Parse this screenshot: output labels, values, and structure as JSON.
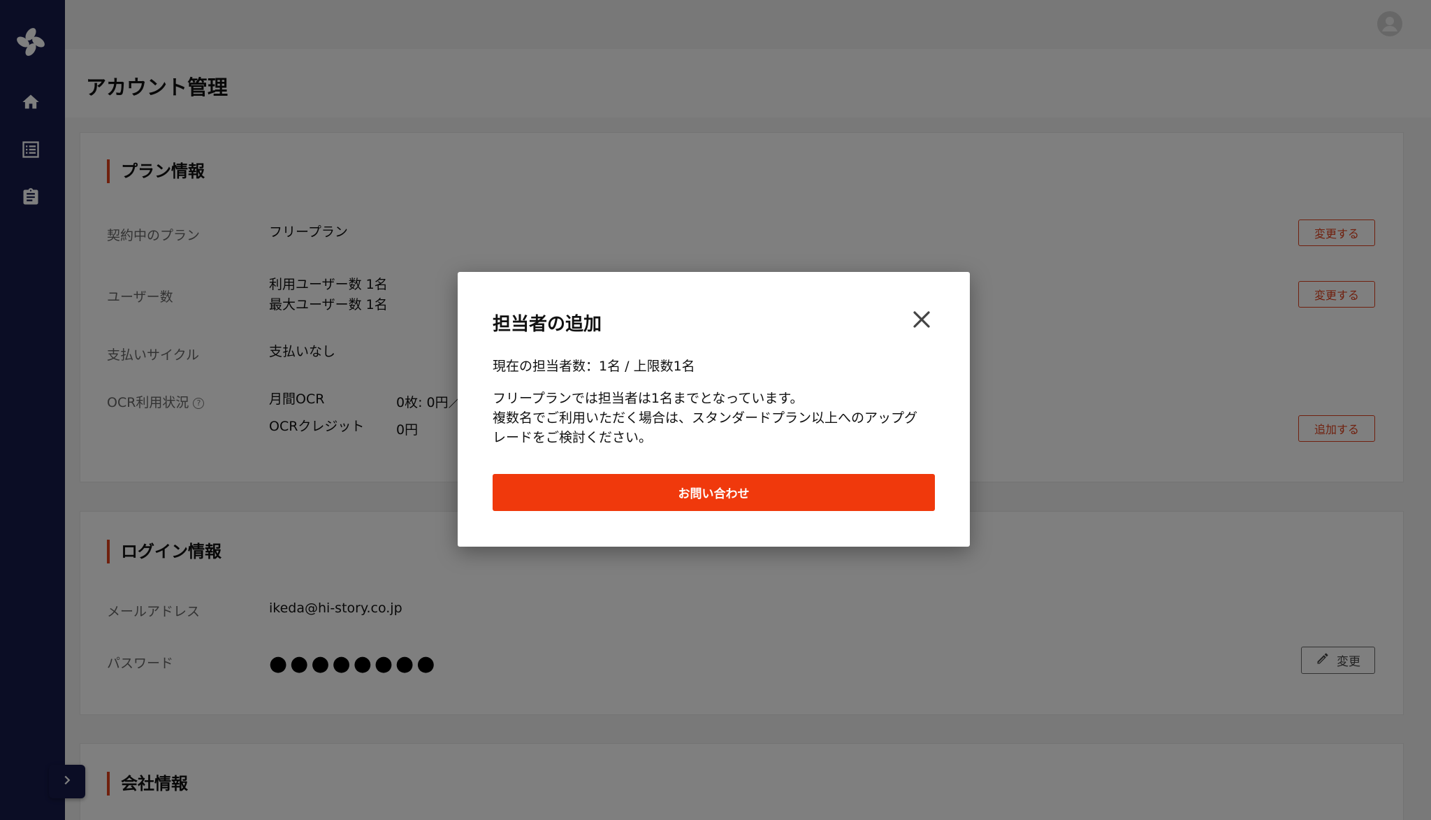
{
  "colors": {
    "sidebar": "#161a4b",
    "accent": "#e1401c",
    "primary_button": "#f0390c"
  },
  "sidebar": {
    "logo": "brand-logo",
    "items": [
      {
        "icon": "home-icon"
      },
      {
        "icon": "list-icon"
      },
      {
        "icon": "clipboard-icon"
      }
    ],
    "expand_icon": "chevron-right-icon"
  },
  "header": {
    "title": "アカウント管理",
    "avatar_icon": "user-avatar-icon"
  },
  "plan": {
    "title": "プラン情報",
    "contract_label": "契約中のプラン",
    "contract_value": "フリープラン",
    "change_label": "変更する",
    "users_label": "ユーザー数",
    "users_current": "利用ユーザー数 1名",
    "users_max": "最大ユーザー数 1名",
    "users_change_label": "変更する",
    "cycle_label": "支払いサイクル",
    "cycle_value": "支払いなし",
    "ocr_label": "OCR利用状況",
    "ocr_help": "?",
    "ocr_monthly_label": "月間OCR",
    "ocr_monthly_value": "0枚: 0円／",
    "ocr_credit_label": "OCRクレジット",
    "ocr_credit_value": "0円",
    "add_label": "追加する"
  },
  "login": {
    "title": "ログイン情報",
    "email_label": "メールアドレス",
    "email_value": "ikeda@hi-story.co.jp",
    "password_label": "パスワード",
    "password_value": "●●●●●●●●",
    "password_change_label": "変更"
  },
  "company": {
    "title": "会社情報"
  },
  "modal": {
    "title": "担当者の追加",
    "close_icon": "close-icon",
    "count_text": "現在の担当者数：1名 / 上限数1名",
    "message_line1": "フリープランでは担当者は1名までとなっています。",
    "message_line2": "複数名でご利用いただく場合は、スタンダードプラン以上へのアップグ",
    "message_line3": "レードをご検討ください。",
    "contact_label": "お問い合わせ"
  }
}
